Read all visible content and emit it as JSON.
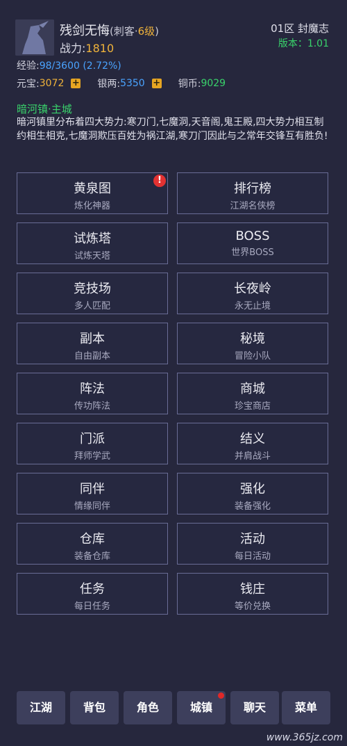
{
  "player": {
    "name": "残剑无悔",
    "class_open": "(刺客·",
    "level": "6级",
    "class_close": ")",
    "power_label": "战力:",
    "power_value": "1810",
    "exp_label": "经验:",
    "exp_value": "98/3600",
    "exp_pct": "(2.72%)"
  },
  "server": {
    "name": "01区 封魔志",
    "version_label": "版本：1.01"
  },
  "currency": {
    "yuanbao_label": "元宝:",
    "yuanbao_value": "3072",
    "yinliang_label": "银两:",
    "yinliang_value": "5350",
    "tongbi_label": "铜币:",
    "tongbi_value": "9029",
    "plus_icon": "+"
  },
  "location": {
    "title": "暗河镇·主城",
    "description": "暗河镇里分布着四大势力:寒刀门,七魔洞,天音阁,鬼王殿,四大势力相互制约相生相克,七魔洞欺压百姓为祸江湖,寒刀门因此与之常年交锋互有胜负!"
  },
  "menu": [
    {
      "title": "黄泉图",
      "sub": "炼化神器",
      "alert": "!"
    },
    {
      "title": "排行榜",
      "sub": "江湖名侠榜"
    },
    {
      "title": "试炼塔",
      "sub": "试炼天塔"
    },
    {
      "title": "BOSS",
      "sub": "世界BOSS"
    },
    {
      "title": "竞技场",
      "sub": "多人匹配"
    },
    {
      "title": "长夜岭",
      "sub": "永无止境"
    },
    {
      "title": "副本",
      "sub": "自由副本"
    },
    {
      "title": "秘境",
      "sub": "冒险小队"
    },
    {
      "title": "阵法",
      "sub": "传功阵法"
    },
    {
      "title": "商城",
      "sub": "珍宝商店"
    },
    {
      "title": "门派",
      "sub": "拜师学武"
    },
    {
      "title": "结义",
      "sub": "并肩战斗"
    },
    {
      "title": "同伴",
      "sub": "情缘同伴"
    },
    {
      "title": "强化",
      "sub": "装备强化"
    },
    {
      "title": "仓库",
      "sub": "装备仓库"
    },
    {
      "title": "活动",
      "sub": "每日活动"
    },
    {
      "title": "任务",
      "sub": "每日任务"
    },
    {
      "title": "钱庄",
      "sub": "等价兑换"
    }
  ],
  "nav": [
    "江湖",
    "背包",
    "角色",
    "城镇",
    "聊天",
    "菜单"
  ],
  "watermark": "www.365jz.com",
  "colors": {
    "background": "#26273d",
    "gold": "#f0b33a",
    "blue": "#4aa3ff",
    "green": "#39d36b",
    "alert_red": "#e23232"
  }
}
